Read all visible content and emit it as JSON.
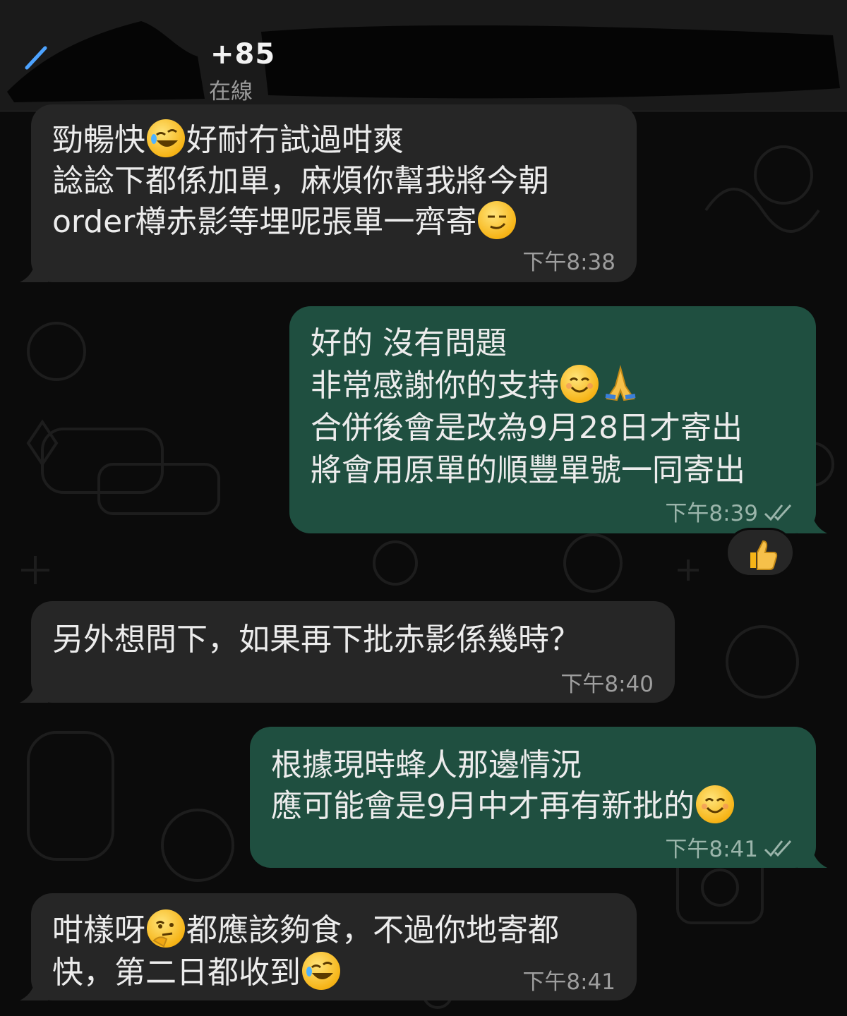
{
  "header": {
    "contact_number": "+85",
    "status": "在線"
  },
  "messages": [
    {
      "direction": "incoming",
      "lines": [
        "勁暢快",
        "好耐冇試過咁爽",
        "諗諗下都係加單，麻煩你幫我將今朝",
        "order樽赤影等埋呢張單一齊寄"
      ],
      "time": "下午8:38"
    },
    {
      "direction": "outgoing",
      "lines": [
        "好的 沒有問題",
        "非常感謝你的支持",
        "合併後會是改為9月28日才寄出",
        "將會用原單的順豐單號一同寄出"
      ],
      "time": "下午8:39",
      "reaction_icon": "thumbs-up"
    },
    {
      "direction": "incoming",
      "lines": [
        "另外想問下，如果再下批赤影係幾時？"
      ],
      "time": "下午8:40"
    },
    {
      "direction": "outgoing",
      "lines": [
        "根據現時蜂人那邊情況",
        "應可能會是9月中才再有新批的"
      ],
      "time": "下午8:41"
    },
    {
      "direction": "incoming",
      "lines": [
        "咁樣呀",
        "都應該夠食，不過你地寄都",
        "快，第二日都收到"
      ],
      "time": "下午8:41"
    }
  ],
  "colors": {
    "background": "#0b0b0b",
    "incoming_bubble": "#262626",
    "outgoing_bubble": "#1f4f40",
    "text": "#ececec",
    "timestamp": "#9e9e9e"
  }
}
